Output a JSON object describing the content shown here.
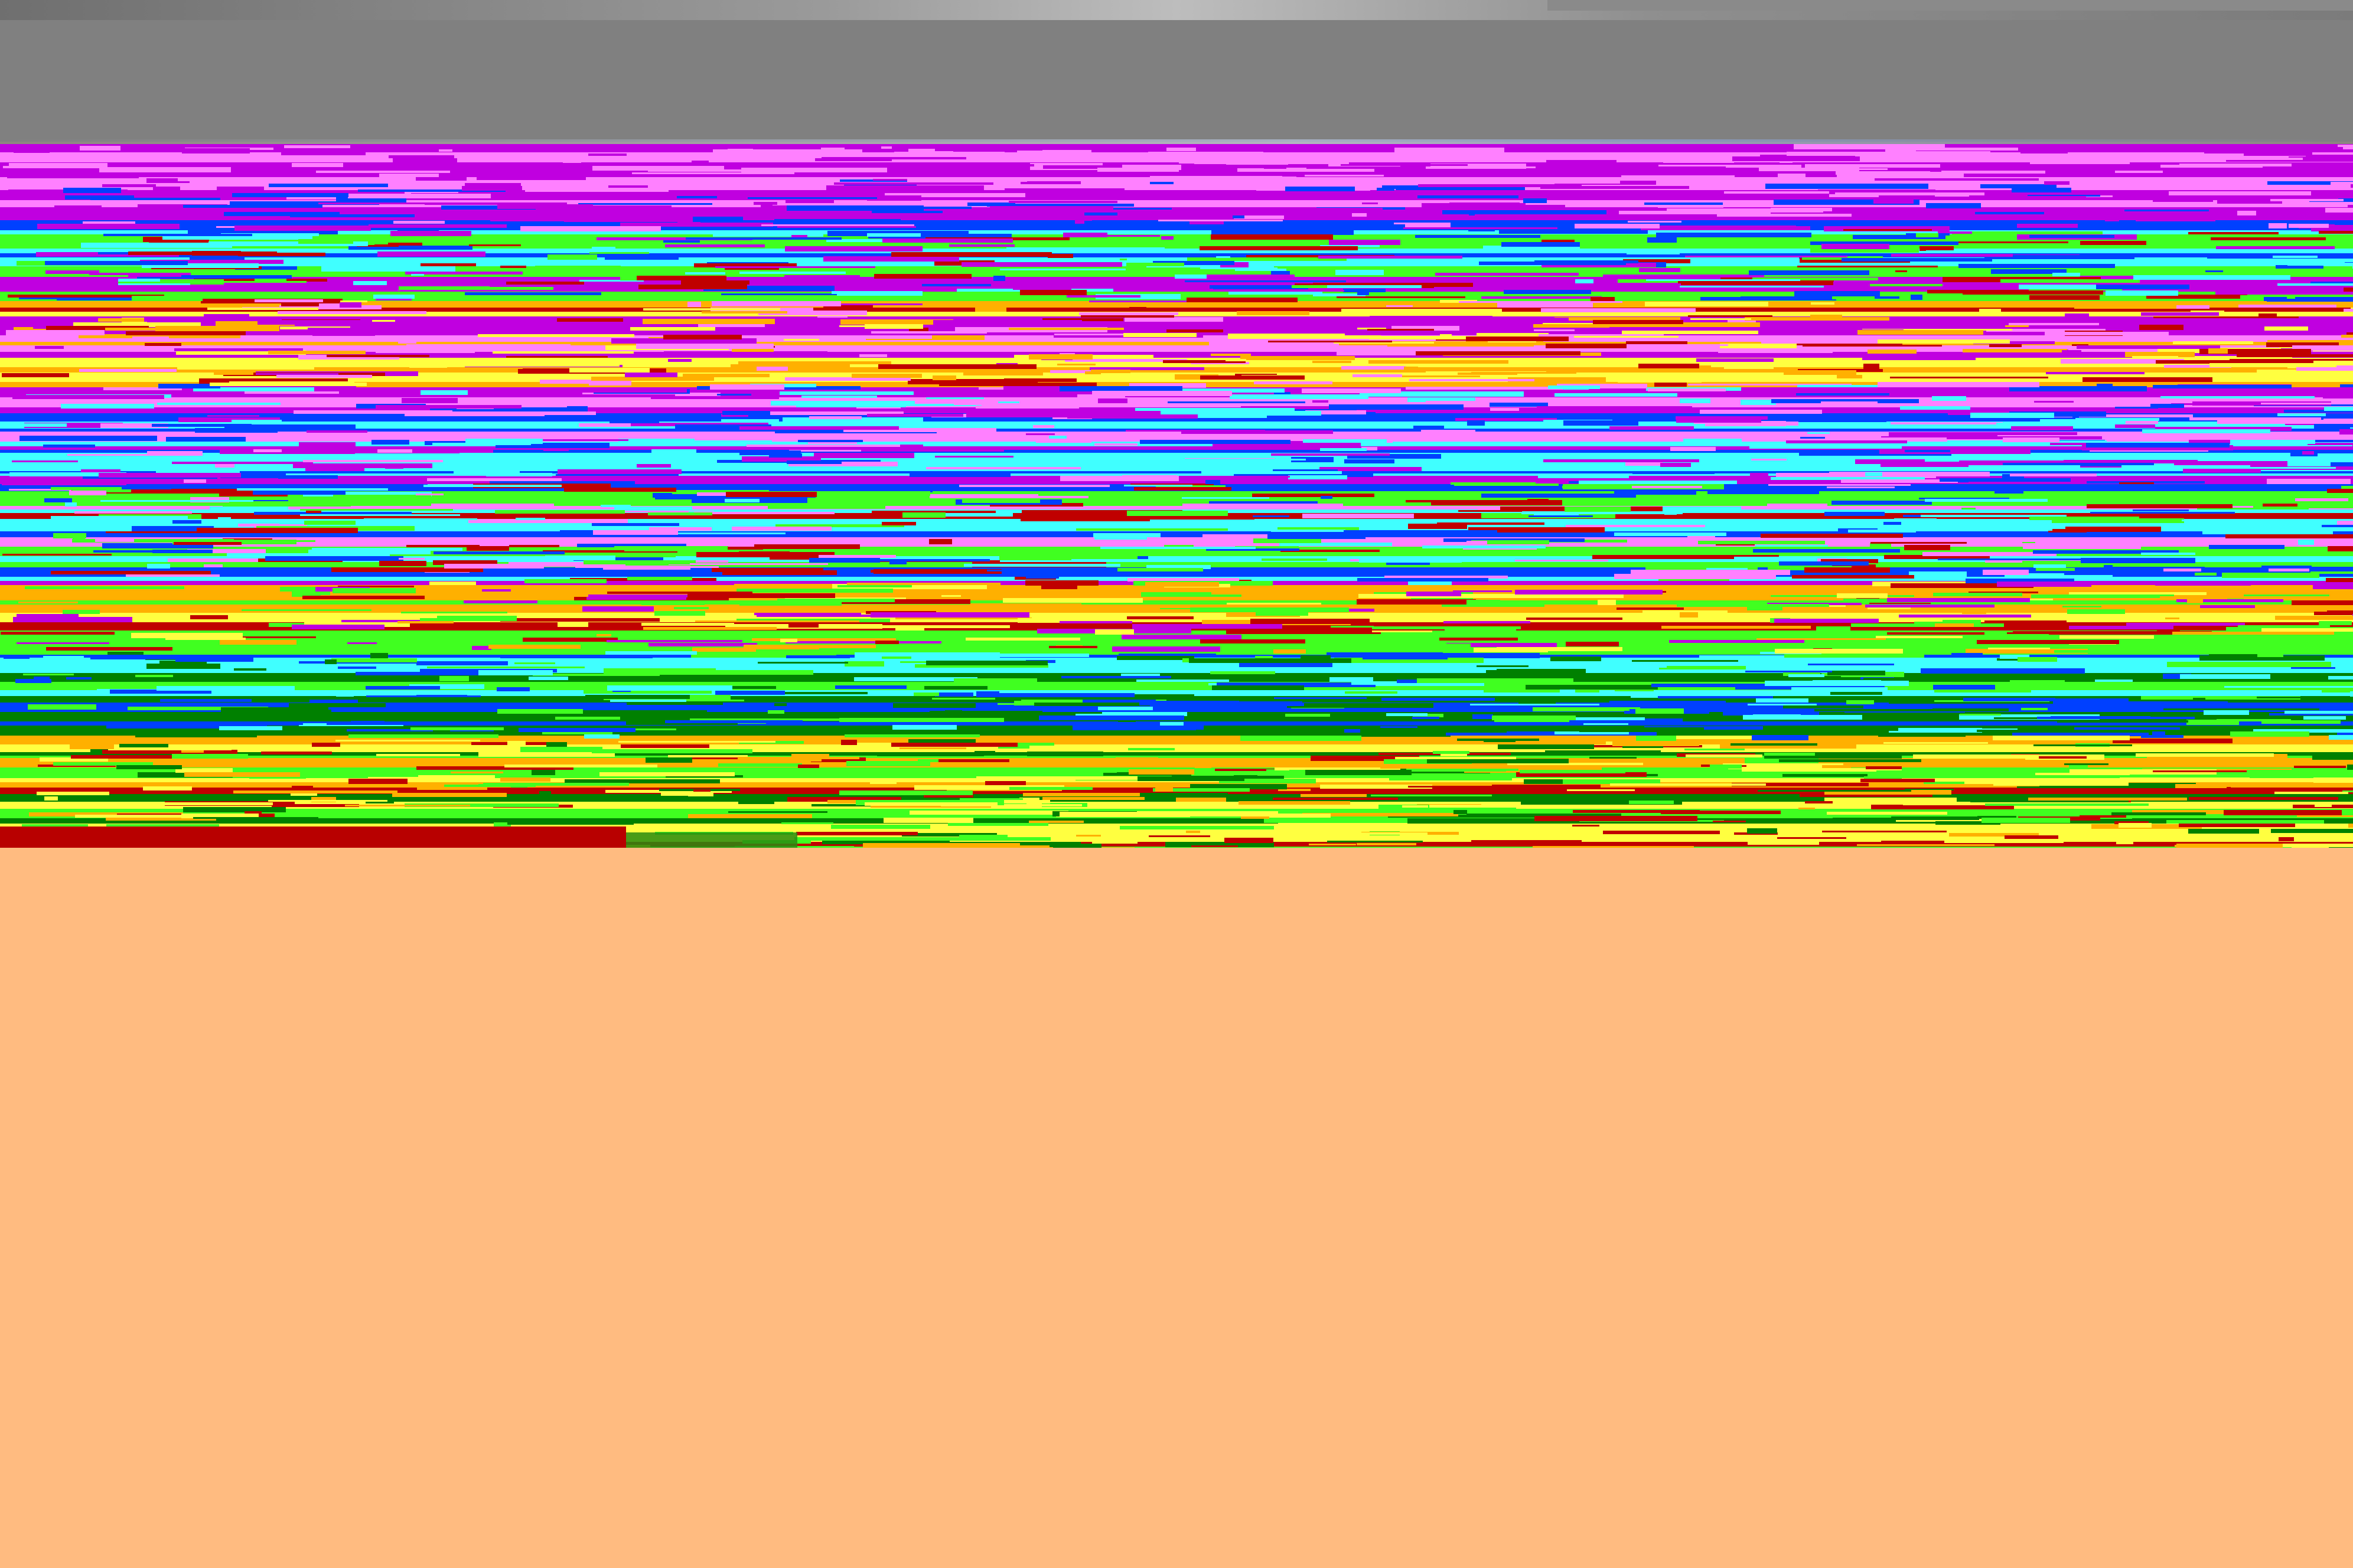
{
  "colors": {
    "grey_band": "#808080",
    "lower_field": "#ffbb80",
    "noise_magenta": "#c000e0",
    "noise_pink": "#ff80ff",
    "noise_cyan": "#40ffff",
    "noise_blue": "#0040ff",
    "noise_green": "#40ff20",
    "noise_darkgreen": "#008000",
    "noise_yellow": "#ffff40",
    "noise_orange": "#ffb000",
    "noise_red": "#c00000"
  }
}
